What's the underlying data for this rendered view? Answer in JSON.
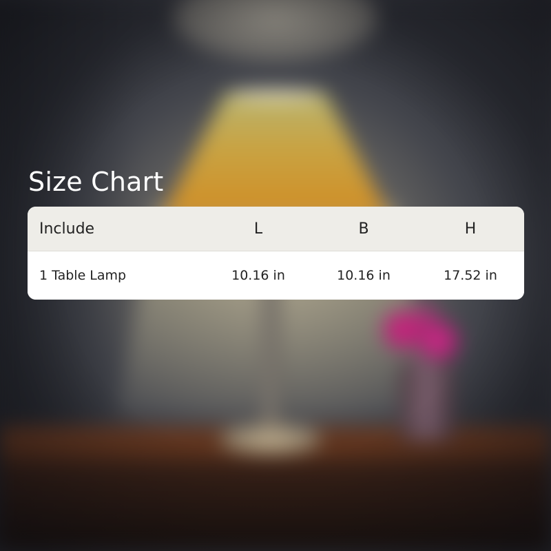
{
  "title": "Size Chart",
  "table": {
    "headers": [
      "Include",
      "L",
      "B",
      "H"
    ],
    "rows": [
      [
        "1 Table Lamp",
        "10.16 in",
        "10.16 in",
        "17.52 in"
      ]
    ]
  },
  "colors": {
    "title_text": "#ffffff",
    "header_background": "#eeede8",
    "row_background": "#ffffff",
    "cell_text": "#222222"
  }
}
